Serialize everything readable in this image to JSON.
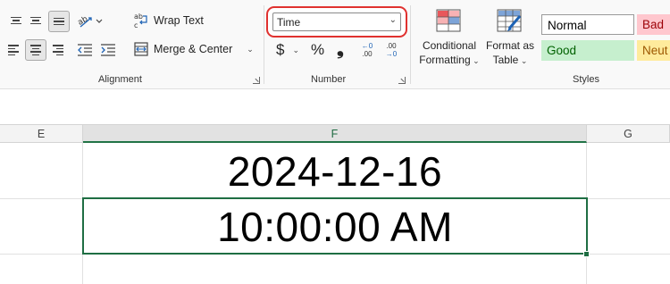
{
  "ribbon": {
    "alignment": {
      "wrap_text_label": "Wrap Text",
      "merge_center_label": "Merge & Center",
      "group_label": "Alignment"
    },
    "number": {
      "format_value": "Time",
      "currency_symbol": "$",
      "percent_symbol": "%",
      "comma_symbol": "❟",
      "increase_decimal_label": ".00",
      "decrease_decimal_label": ".00",
      "group_label": "Number"
    },
    "styles": {
      "conditional_formatting_line1": "Conditional",
      "conditional_formatting_line2": "Formatting",
      "format_as_table_line1": "Format as",
      "format_as_table_line2": "Table",
      "cell_styles": [
        {
          "label": "Normal",
          "bg": "#ffffff",
          "fg": "#000000"
        },
        {
          "label": "Bad",
          "bg": "#ffc7ce",
          "fg": "#9c0006"
        },
        {
          "label": "Good",
          "bg": "#c6efce",
          "fg": "#006100"
        },
        {
          "label": "Neut",
          "bg": "#ffeb9c",
          "fg": "#9c5700"
        }
      ],
      "group_label": "Styles"
    }
  },
  "sheet": {
    "columns": [
      "E",
      "F",
      "G"
    ],
    "active_column": "F",
    "cells": {
      "f_row1": "2024-12-16",
      "f_row2": "10:00:00 AM"
    }
  },
  "colors": {
    "accent_green": "#217346",
    "highlight_red": "#e0312f"
  }
}
